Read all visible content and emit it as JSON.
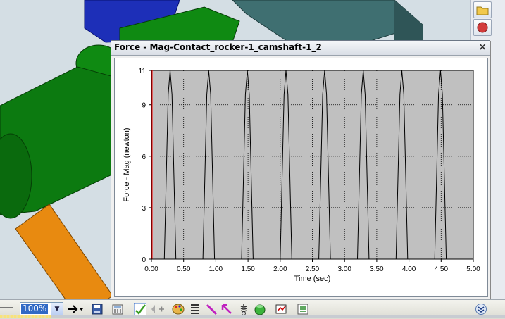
{
  "window": {
    "title": "Force - Mag-Contact_rocker-1_camshaft-1_2",
    "close_label": "×"
  },
  "toolbar": {
    "zoom_value": "100%"
  },
  "icons": {
    "right_strip": [
      "folder-icon",
      "record-icon"
    ],
    "toolbar": [
      "play-arrow-icon",
      "save-icon",
      "calculator-icon",
      "edit-check-icon",
      "add-point-icon",
      "palette-icon",
      "list-icon",
      "pen-icon",
      "cursor-arrow-icon",
      "spring-icon",
      "motor-icon",
      "chart-view-icon",
      "results-list-icon",
      "chevron-down-icon"
    ]
  },
  "progress": {
    "fraction": 0.1
  },
  "chart_data": {
    "type": "line",
    "title": "",
    "xlabel": "Time (sec)",
    "ylabel": "Force - Mag (newton)",
    "xlim": [
      0,
      5
    ],
    "ylim": [
      0,
      11
    ],
    "x_ticks": [
      "0.00",
      "0.50",
      "1.00",
      "1.50",
      "2.00",
      "2.50",
      "3.00",
      "3.50",
      "4.00",
      "4.50",
      "5.00"
    ],
    "y_ticks": [
      "0",
      "3",
      "6",
      "9",
      "11"
    ],
    "grid": true,
    "background": "#c0c0c0",
    "line_color": "#000000",
    "axis_line_color": "#ff0000",
    "series": [
      {
        "x": [
          0.0,
          0.2,
          0.26,
          0.29,
          0.32,
          0.38,
          0.8,
          0.86,
          0.89,
          0.92,
          0.98,
          1.4,
          1.46,
          1.49,
          1.52,
          1.58,
          2.0,
          2.06,
          2.09,
          2.12,
          2.18,
          2.6,
          2.66,
          2.69,
          2.72,
          2.78,
          3.2,
          3.26,
          3.29,
          3.32,
          3.38,
          3.8,
          3.86,
          3.89,
          3.92,
          3.98,
          4.4,
          4.46,
          4.49,
          4.52,
          4.58,
          5.0
        ],
        "y": [
          0,
          0,
          9.6,
          11,
          9.6,
          0,
          0,
          9.6,
          11,
          9.6,
          0,
          0,
          9.6,
          11,
          9.6,
          0,
          0,
          9.6,
          11,
          9.6,
          0,
          0,
          9.6,
          11,
          9.6,
          0,
          0,
          9.6,
          11,
          9.6,
          0,
          0,
          9.6,
          11,
          9.6,
          0,
          0,
          9.6,
          11,
          9.6,
          0,
          0
        ]
      }
    ]
  }
}
